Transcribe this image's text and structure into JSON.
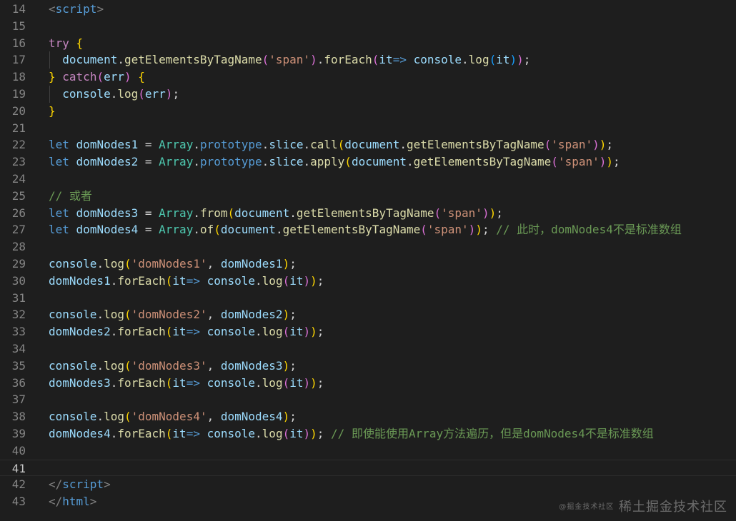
{
  "colors": {
    "background": "#1e1e1e",
    "line_number": "#858585",
    "tag": "#808080",
    "keyword": "#c586c0",
    "storage": "#569cd6",
    "variable": "#9cdcfe",
    "function": "#dcdcaa",
    "class": "#4ec9b0",
    "string": "#ce9178",
    "comment": "#6a9955",
    "punctuation": "#d4d4d4",
    "bracket_gold": "#ffd700",
    "bracket_purple": "#da70d6",
    "bracket_blue": "#179fff"
  },
  "editor": {
    "current_line": 41,
    "lines": [
      {
        "n": "14",
        "tokens": [
          [
            "<",
            "tag"
          ],
          [
            "script",
            "storage"
          ],
          [
            ">",
            "tag"
          ]
        ]
      },
      {
        "n": "15",
        "tokens": []
      },
      {
        "n": "16",
        "tokens": [
          [
            "try",
            "keyword"
          ],
          [
            " ",
            "punctuation"
          ],
          [
            "{",
            "bracket_gold"
          ]
        ]
      },
      {
        "n": "17",
        "indent": true,
        "tokens": [
          [
            "  ",
            "punctuation"
          ],
          [
            "document",
            "variable"
          ],
          [
            ".",
            "punctuation"
          ],
          [
            "getElementsByTagName",
            "function"
          ],
          [
            "(",
            "bracket_purple"
          ],
          [
            "'span'",
            "string"
          ],
          [
            ")",
            "bracket_purple"
          ],
          [
            ".",
            "punctuation"
          ],
          [
            "forEach",
            "function"
          ],
          [
            "(",
            "bracket_purple"
          ],
          [
            "it",
            "variable"
          ],
          [
            "=>",
            "storage"
          ],
          [
            " ",
            "punctuation"
          ],
          [
            "console",
            "variable"
          ],
          [
            ".",
            "punctuation"
          ],
          [
            "log",
            "function"
          ],
          [
            "(",
            "bracket_blue"
          ],
          [
            "it",
            "variable"
          ],
          [
            ")",
            "bracket_blue"
          ],
          [
            ")",
            "bracket_purple"
          ],
          [
            ";",
            "punctuation"
          ]
        ]
      },
      {
        "n": "18",
        "tokens": [
          [
            "}",
            "bracket_gold"
          ],
          [
            " ",
            "punctuation"
          ],
          [
            "catch",
            "keyword"
          ],
          [
            "(",
            "bracket_purple"
          ],
          [
            "err",
            "variable"
          ],
          [
            ")",
            "bracket_purple"
          ],
          [
            " ",
            "punctuation"
          ],
          [
            "{",
            "bracket_gold"
          ]
        ]
      },
      {
        "n": "19",
        "indent": true,
        "tokens": [
          [
            "  ",
            "punctuation"
          ],
          [
            "console",
            "variable"
          ],
          [
            ".",
            "punctuation"
          ],
          [
            "log",
            "function"
          ],
          [
            "(",
            "bracket_purple"
          ],
          [
            "err",
            "variable"
          ],
          [
            ")",
            "bracket_purple"
          ],
          [
            ";",
            "punctuation"
          ]
        ]
      },
      {
        "n": "20",
        "tokens": [
          [
            "}",
            "bracket_gold"
          ]
        ]
      },
      {
        "n": "21",
        "tokens": []
      },
      {
        "n": "22",
        "tokens": [
          [
            "let",
            "storage"
          ],
          [
            " ",
            "punctuation"
          ],
          [
            "domNodes1",
            "variable"
          ],
          [
            " = ",
            "punctuation"
          ],
          [
            "Array",
            "class"
          ],
          [
            ".",
            "punctuation"
          ],
          [
            "prototype",
            "storage"
          ],
          [
            ".",
            "punctuation"
          ],
          [
            "slice",
            "variable"
          ],
          [
            ".",
            "punctuation"
          ],
          [
            "call",
            "function"
          ],
          [
            "(",
            "bracket_gold"
          ],
          [
            "document",
            "variable"
          ],
          [
            ".",
            "punctuation"
          ],
          [
            "getElementsByTagName",
            "function"
          ],
          [
            "(",
            "bracket_purple"
          ],
          [
            "'span'",
            "string"
          ],
          [
            ")",
            "bracket_purple"
          ],
          [
            ")",
            "bracket_gold"
          ],
          [
            ";",
            "punctuation"
          ]
        ]
      },
      {
        "n": "23",
        "tokens": [
          [
            "let",
            "storage"
          ],
          [
            " ",
            "punctuation"
          ],
          [
            "domNodes2",
            "variable"
          ],
          [
            " = ",
            "punctuation"
          ],
          [
            "Array",
            "class"
          ],
          [
            ".",
            "punctuation"
          ],
          [
            "prototype",
            "storage"
          ],
          [
            ".",
            "punctuation"
          ],
          [
            "slice",
            "variable"
          ],
          [
            ".",
            "punctuation"
          ],
          [
            "apply",
            "function"
          ],
          [
            "(",
            "bracket_gold"
          ],
          [
            "document",
            "variable"
          ],
          [
            ".",
            "punctuation"
          ],
          [
            "getElementsByTagName",
            "function"
          ],
          [
            "(",
            "bracket_purple"
          ],
          [
            "'span'",
            "string"
          ],
          [
            ")",
            "bracket_purple"
          ],
          [
            ")",
            "bracket_gold"
          ],
          [
            ";",
            "punctuation"
          ]
        ]
      },
      {
        "n": "24",
        "tokens": []
      },
      {
        "n": "25",
        "tokens": [
          [
            "// 或者",
            "comment"
          ]
        ]
      },
      {
        "n": "26",
        "tokens": [
          [
            "let",
            "storage"
          ],
          [
            " ",
            "punctuation"
          ],
          [
            "domNodes3",
            "variable"
          ],
          [
            " = ",
            "punctuation"
          ],
          [
            "Array",
            "class"
          ],
          [
            ".",
            "punctuation"
          ],
          [
            "from",
            "function"
          ],
          [
            "(",
            "bracket_gold"
          ],
          [
            "document",
            "variable"
          ],
          [
            ".",
            "punctuation"
          ],
          [
            "getElementsByTagName",
            "function"
          ],
          [
            "(",
            "bracket_purple"
          ],
          [
            "'span'",
            "string"
          ],
          [
            ")",
            "bracket_purple"
          ],
          [
            ")",
            "bracket_gold"
          ],
          [
            ";",
            "punctuation"
          ]
        ]
      },
      {
        "n": "27",
        "tokens": [
          [
            "let",
            "storage"
          ],
          [
            " ",
            "punctuation"
          ],
          [
            "domNodes4",
            "variable"
          ],
          [
            " = ",
            "punctuation"
          ],
          [
            "Array",
            "class"
          ],
          [
            ".",
            "punctuation"
          ],
          [
            "of",
            "function"
          ],
          [
            "(",
            "bracket_gold"
          ],
          [
            "document",
            "variable"
          ],
          [
            ".",
            "punctuation"
          ],
          [
            "getElementsByTagName",
            "function"
          ],
          [
            "(",
            "bracket_purple"
          ],
          [
            "'span'",
            "string"
          ],
          [
            ")",
            "bracket_purple"
          ],
          [
            ")",
            "bracket_gold"
          ],
          [
            ";",
            "punctuation"
          ],
          [
            " ",
            "punctuation"
          ],
          [
            "// 此时，domNodes4不是标准数组",
            "comment"
          ]
        ]
      },
      {
        "n": "28",
        "tokens": []
      },
      {
        "n": "29",
        "tokens": [
          [
            "console",
            "variable"
          ],
          [
            ".",
            "punctuation"
          ],
          [
            "log",
            "function"
          ],
          [
            "(",
            "bracket_gold"
          ],
          [
            "'domNodes1'",
            "string"
          ],
          [
            ", ",
            "punctuation"
          ],
          [
            "domNodes1",
            "variable"
          ],
          [
            ")",
            "bracket_gold"
          ],
          [
            ";",
            "punctuation"
          ]
        ]
      },
      {
        "n": "30",
        "tokens": [
          [
            "domNodes1",
            "variable"
          ],
          [
            ".",
            "punctuation"
          ],
          [
            "forEach",
            "function"
          ],
          [
            "(",
            "bracket_gold"
          ],
          [
            "it",
            "variable"
          ],
          [
            "=>",
            "storage"
          ],
          [
            " ",
            "punctuation"
          ],
          [
            "console",
            "variable"
          ],
          [
            ".",
            "punctuation"
          ],
          [
            "log",
            "function"
          ],
          [
            "(",
            "bracket_purple"
          ],
          [
            "it",
            "variable"
          ],
          [
            ")",
            "bracket_purple"
          ],
          [
            ")",
            "bracket_gold"
          ],
          [
            ";",
            "punctuation"
          ]
        ]
      },
      {
        "n": "31",
        "tokens": []
      },
      {
        "n": "32",
        "tokens": [
          [
            "console",
            "variable"
          ],
          [
            ".",
            "punctuation"
          ],
          [
            "log",
            "function"
          ],
          [
            "(",
            "bracket_gold"
          ],
          [
            "'domNodes2'",
            "string"
          ],
          [
            ", ",
            "punctuation"
          ],
          [
            "domNodes2",
            "variable"
          ],
          [
            ")",
            "bracket_gold"
          ],
          [
            ";",
            "punctuation"
          ]
        ]
      },
      {
        "n": "33",
        "tokens": [
          [
            "domNodes2",
            "variable"
          ],
          [
            ".",
            "punctuation"
          ],
          [
            "forEach",
            "function"
          ],
          [
            "(",
            "bracket_gold"
          ],
          [
            "it",
            "variable"
          ],
          [
            "=>",
            "storage"
          ],
          [
            " ",
            "punctuation"
          ],
          [
            "console",
            "variable"
          ],
          [
            ".",
            "punctuation"
          ],
          [
            "log",
            "function"
          ],
          [
            "(",
            "bracket_purple"
          ],
          [
            "it",
            "variable"
          ],
          [
            ")",
            "bracket_purple"
          ],
          [
            ")",
            "bracket_gold"
          ],
          [
            ";",
            "punctuation"
          ]
        ]
      },
      {
        "n": "34",
        "tokens": []
      },
      {
        "n": "35",
        "tokens": [
          [
            "console",
            "variable"
          ],
          [
            ".",
            "punctuation"
          ],
          [
            "log",
            "function"
          ],
          [
            "(",
            "bracket_gold"
          ],
          [
            "'domNodes3'",
            "string"
          ],
          [
            ", ",
            "punctuation"
          ],
          [
            "domNodes3",
            "variable"
          ],
          [
            ")",
            "bracket_gold"
          ],
          [
            ";",
            "punctuation"
          ]
        ]
      },
      {
        "n": "36",
        "tokens": [
          [
            "domNodes3",
            "variable"
          ],
          [
            ".",
            "punctuation"
          ],
          [
            "forEach",
            "function"
          ],
          [
            "(",
            "bracket_gold"
          ],
          [
            "it",
            "variable"
          ],
          [
            "=>",
            "storage"
          ],
          [
            " ",
            "punctuation"
          ],
          [
            "console",
            "variable"
          ],
          [
            ".",
            "punctuation"
          ],
          [
            "log",
            "function"
          ],
          [
            "(",
            "bracket_purple"
          ],
          [
            "it",
            "variable"
          ],
          [
            ")",
            "bracket_purple"
          ],
          [
            ")",
            "bracket_gold"
          ],
          [
            ";",
            "punctuation"
          ]
        ]
      },
      {
        "n": "37",
        "tokens": []
      },
      {
        "n": "38",
        "tokens": [
          [
            "console",
            "variable"
          ],
          [
            ".",
            "punctuation"
          ],
          [
            "log",
            "function"
          ],
          [
            "(",
            "bracket_gold"
          ],
          [
            "'domNodes4'",
            "string"
          ],
          [
            ", ",
            "punctuation"
          ],
          [
            "domNodes4",
            "variable"
          ],
          [
            ")",
            "bracket_gold"
          ],
          [
            ";",
            "punctuation"
          ]
        ]
      },
      {
        "n": "39",
        "tokens": [
          [
            "domNodes4",
            "variable"
          ],
          [
            ".",
            "punctuation"
          ],
          [
            "forEach",
            "function"
          ],
          [
            "(",
            "bracket_gold"
          ],
          [
            "it",
            "variable"
          ],
          [
            "=>",
            "storage"
          ],
          [
            " ",
            "punctuation"
          ],
          [
            "console",
            "variable"
          ],
          [
            ".",
            "punctuation"
          ],
          [
            "log",
            "function"
          ],
          [
            "(",
            "bracket_purple"
          ],
          [
            "it",
            "variable"
          ],
          [
            ")",
            "bracket_purple"
          ],
          [
            ")",
            "bracket_gold"
          ],
          [
            ";",
            "punctuation"
          ],
          [
            " ",
            "punctuation"
          ],
          [
            "// 即使能使用Array方法遍历，但是domNodes4不是标准数组",
            "comment"
          ]
        ]
      },
      {
        "n": "40",
        "tokens": []
      },
      {
        "n": "41",
        "tokens": []
      },
      {
        "n": "42",
        "tokens": [
          [
            "</",
            "tag"
          ],
          [
            "script",
            "storage"
          ],
          [
            ">",
            "tag"
          ]
        ]
      },
      {
        "n": "43",
        "tokens": [
          [
            "</",
            "tag"
          ],
          [
            "html",
            "storage"
          ],
          [
            ">",
            "tag"
          ]
        ]
      }
    ]
  },
  "watermark": {
    "small": "@掘金技术社区",
    "main": "稀土掘金技术社区"
  }
}
